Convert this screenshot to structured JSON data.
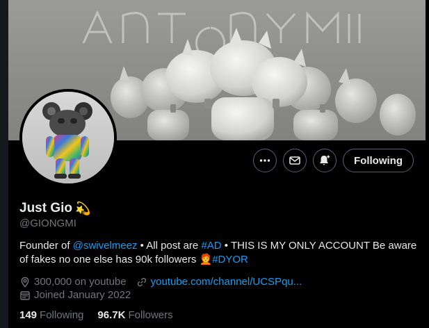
{
  "banner": {
    "title_art": "ANTONYM",
    "icon": "banner-figures-image"
  },
  "profile": {
    "name": "Just Gio",
    "name_emoji": "💫",
    "handle": "@GIONGMI"
  },
  "actions": {
    "more_icon": "more-icon",
    "message_icon": "mail-icon",
    "notify_icon": "bell-plus-icon",
    "following_label": "Following"
  },
  "bio": {
    "p1": "Founder of ",
    "link1": "@swivelmeez",
    "p2": " • All post are ",
    "link2": "#AD",
    "p3": " • THIS IS MY ONLY ACCOUNT Be aware of fakes no one else has 90k followers ",
    "emoji": "🧑‍🦰",
    "link3": "#DYOR"
  },
  "meta": {
    "location": "300,000 on youtube",
    "website": "youtube.com/channel/UCSPqu...",
    "joined": "Joined January 2022"
  },
  "stats": {
    "following_count": "149",
    "following_label": "Following",
    "followers_count": "96.7K",
    "followers_label": "Followers"
  },
  "colors": {
    "accent": "#1d9bf0",
    "muted": "#71767b",
    "text": "#e7e9ea",
    "border": "#536471"
  }
}
